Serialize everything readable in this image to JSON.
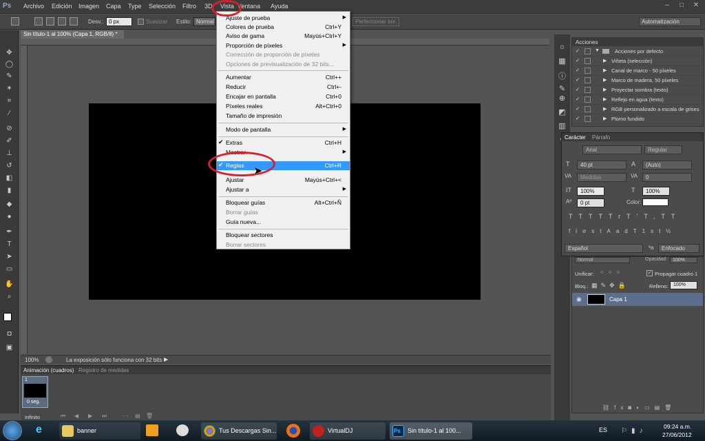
{
  "menubar": {
    "items": [
      "Archivo",
      "Edición",
      "Imagen",
      "Capa",
      "Type",
      "Selección",
      "Filtro",
      "3D",
      "Vista",
      "Ventana",
      "Ayuda"
    ],
    "logo": "Ps"
  },
  "options": {
    "desv_label": "Desv.:",
    "desv_value": "0 px",
    "suavizar": "Suavizar",
    "estilo_label": "Estilo:",
    "estilo_value": "Normal",
    "perfeccionar": "Perfeccionar bor.",
    "workspace": "Automatización"
  },
  "doc": {
    "tab": "Sin título-1 al 100% (Capa 1, RGB/8) *",
    "zoom": "100%",
    "status": "La exposición sólo funciona con 32 bits"
  },
  "vista_menu": [
    {
      "label": "Ajuste de prueba",
      "shortcut": "",
      "arrow": true
    },
    {
      "label": "Colores de prueba",
      "shortcut": "Ctrl+Y"
    },
    {
      "label": "Aviso de gama",
      "shortcut": "Mayús+Ctrl+Y"
    },
    {
      "label": "Proporción de píxeles",
      "shortcut": "",
      "arrow": true
    },
    {
      "label": "Corrección de proporción de píxeles",
      "shortcut": "",
      "disabled": true
    },
    {
      "label": "Opciones de previsualización de 32 bits...",
      "shortcut": "",
      "disabled": true
    },
    {
      "label": "Aumentar",
      "shortcut": "Ctrl++"
    },
    {
      "label": "Reducir",
      "shortcut": "Ctrl+-"
    },
    {
      "label": "Encajar en pantalla",
      "shortcut": "Ctrl+0"
    },
    {
      "label": "Píxeles reales",
      "shortcut": "Alt+Ctrl+0"
    },
    {
      "label": "Tamaño de impresión",
      "shortcut": ""
    },
    {
      "label": "Modo de pantalla",
      "shortcut": "",
      "arrow": true
    },
    {
      "label": "Extras",
      "shortcut": "Ctrl+H",
      "checked": true
    },
    {
      "label": "Mostrar",
      "shortcut": "",
      "arrow": true
    },
    {
      "label": "Reglas",
      "shortcut": "Ctrl+R",
      "checked": true,
      "highlighted": true
    },
    {
      "label": "Ajustar",
      "shortcut": "Mayús+Ctrl+<"
    },
    {
      "label": "Ajustar a",
      "shortcut": "",
      "arrow": true
    },
    {
      "label": "Bloquear guías",
      "shortcut": "Alt+Ctrl+Ñ"
    },
    {
      "label": "Borrar guías",
      "shortcut": "",
      "disabled": true
    },
    {
      "label": "Guía nueva...",
      "shortcut": ""
    },
    {
      "label": "Bloquear sectores",
      "shortcut": ""
    },
    {
      "label": "Borrar sectores",
      "shortcut": "",
      "disabled": true
    }
  ],
  "actions": {
    "title": "Acciones",
    "items": [
      "Acciones por defecto",
      "Viñeta (selección)",
      "Canal de marco - 50 píxeles",
      "Marco de madera, 50 píxeles",
      "Proyectar sombra (texto)",
      "Reflejo en agua (texto)",
      "RGB personalizado a escala de grises",
      "Plomo fundido"
    ]
  },
  "character": {
    "tab1": "Carácter",
    "tab2": "Párrafo",
    "font": "Arial",
    "style": "Regular",
    "size": "40 pt",
    "leading": "(Auto)",
    "kerning": "Medidas",
    "tracking": "0",
    "vscale": "100%",
    "hscale": "100%",
    "baseline": "0 pt",
    "color_label": "Color:",
    "language": "Español",
    "aa": "Enfocado",
    "glyphs": [
      "T",
      "T",
      "TT",
      "Tr",
      "T'",
      "T,",
      "T",
      "T"
    ],
    "ot": [
      "fi",
      "ơ",
      "st",
      "A",
      "ad",
      "T",
      "1st",
      "½"
    ]
  },
  "layers": {
    "blend": "Normal",
    "opacity_label": "Opacidad:",
    "opacity": "100%",
    "unify": "Unificar:",
    "propagate": "Propagar cuadro 1",
    "lock": "Bloq.:",
    "fill_label": "Relleno:",
    "fill": "100%",
    "layer_name": "Capa 1"
  },
  "animation": {
    "tab1": "Animación (cuadros)",
    "tab2": "Registro de medidas",
    "frame_num": "1",
    "frame_time": "0 seg.",
    "loop": "Infinito"
  },
  "taskbar": {
    "items": [
      "banner",
      "Tus Descargas Sin...",
      "VirtualDJ",
      "Sin título-1 al 100..."
    ],
    "lang": "ES",
    "time": "09:24 a.m.",
    "date": "27/06/2012"
  },
  "colors": {
    "highlight": "#3399ff",
    "annotation": "#d8202a"
  }
}
